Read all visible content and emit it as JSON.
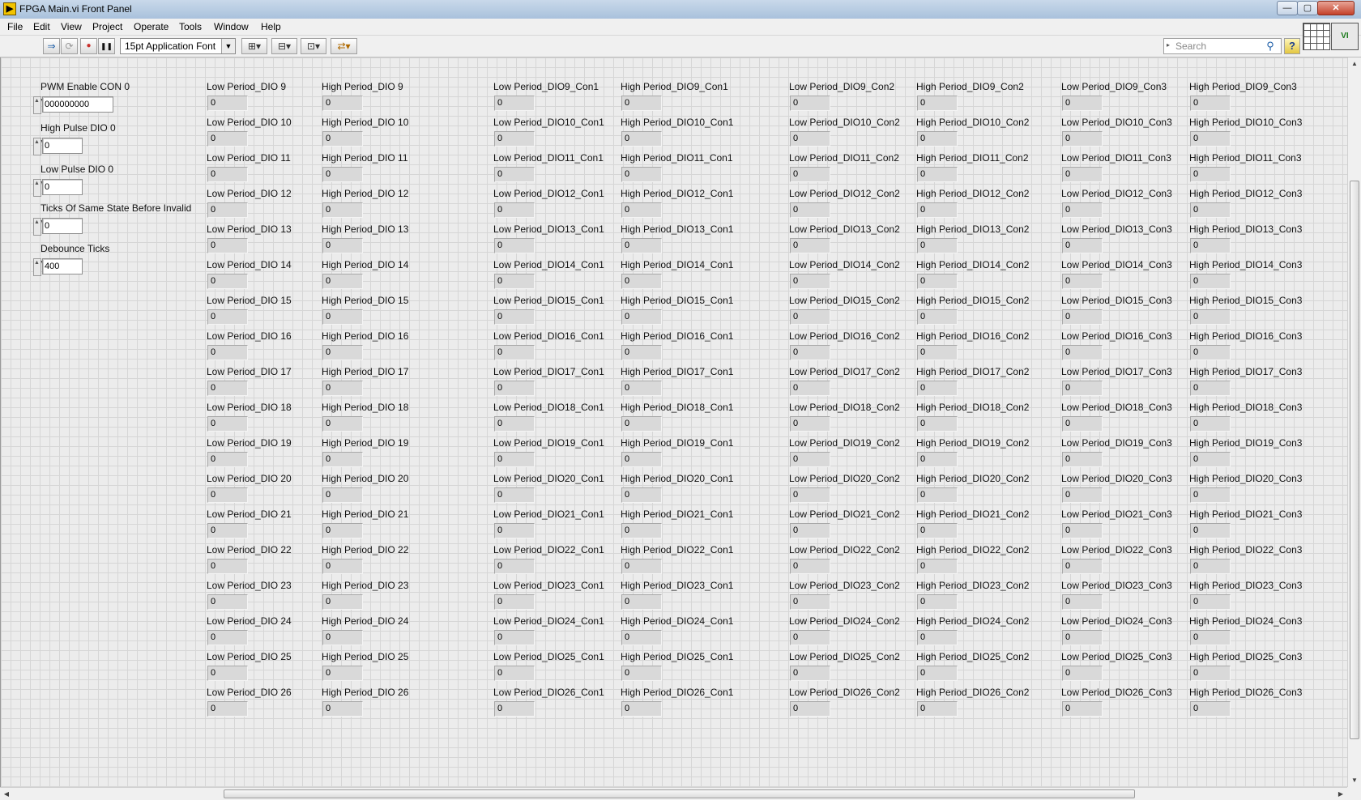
{
  "window": {
    "title": "FPGA Main.vi Front Panel",
    "icon_glyph": "▶",
    "minimize_glyph": "—",
    "maximize_glyph": "▢",
    "close_glyph": "✕"
  },
  "menu": [
    "File",
    "Edit",
    "View",
    "Project",
    "Operate",
    "Tools",
    "Window",
    "Help"
  ],
  "toolbar": {
    "run_glyph": "⇒",
    "run_continuous_glyph": "⟳",
    "abort_glyph": "●",
    "pause_glyph": "❚❚",
    "font_label": "15pt Application Font",
    "font_arrow_glyph": "▼",
    "align_glyph": "⊞▾",
    "distribute_glyph": "⊟▾",
    "resize_glyph": "⊡▾",
    "reorder_glyph": "⇄▾"
  },
  "search": {
    "placeholder": "Search",
    "arrow_glyph": "▸",
    "icon_glyph": "⚲"
  },
  "help": {
    "glyph": "?"
  },
  "vi_icon": {
    "text": "VI"
  },
  "controls": [
    {
      "label": "PWM Enable CON 0",
      "value": "000000000"
    },
    {
      "label": "High Pulse DIO 0",
      "value": "0"
    },
    {
      "label": "Low Pulse DIO 0",
      "value": "0"
    },
    {
      "label": "Ticks Of Same State Before Invalid",
      "value": "0"
    },
    {
      "label": "Debounce Ticks",
      "value": "400"
    }
  ],
  "spinner_glyph": "▲▼",
  "indicator_rows": [
    9,
    10,
    11,
    12,
    13,
    14,
    15,
    16,
    17,
    18,
    19,
    20,
    21,
    22,
    23,
    24,
    25,
    26
  ],
  "indicator_groups": [
    {
      "low": "Low Period_DIO {n}",
      "high": "High Period_DIO {n}"
    },
    {
      "low": "Low Period_DIO{n}_Con1",
      "high": "High Period_DIO{n}_Con1"
    },
    {
      "low": "Low Period_DIO{n}_Con2",
      "high": "High Period_DIO{n}_Con2"
    },
    {
      "low": "Low Period_DIO{n}_Con3",
      "high": "High Period_DIO{n}_Con3"
    }
  ],
  "indicator_value": "0",
  "scroll": {
    "up_glyph": "▲",
    "down_glyph": "▼",
    "left_glyph": "◀",
    "right_glyph": "▶"
  }
}
